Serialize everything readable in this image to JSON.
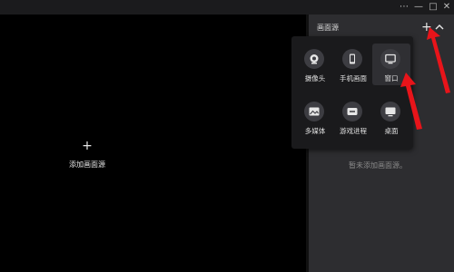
{
  "window": {
    "controls": [
      "⋯",
      "—",
      "□",
      "✕"
    ]
  },
  "preview": {
    "add_icon": "+",
    "add_label": "添加画面源"
  },
  "panel": {
    "title": "画面源",
    "add_icon": "+",
    "empty_text": "暂未添加画面源。"
  },
  "source_menu": {
    "items": [
      {
        "label": "摄像头",
        "icon": "camera-icon"
      },
      {
        "label": "手机画面",
        "icon": "phone-icon"
      },
      {
        "label": "窗口",
        "icon": "window-icon",
        "highlighted": true
      },
      {
        "label": "多媒体",
        "icon": "media-icon"
      },
      {
        "label": "游戏进程",
        "icon": "game-icon"
      },
      {
        "label": "桌面",
        "icon": "desktop-icon"
      }
    ]
  },
  "colors": {
    "background": "#000000",
    "panel": "#2d2d30",
    "popup": "#1a1a1c",
    "arrow": "#e8141a"
  }
}
